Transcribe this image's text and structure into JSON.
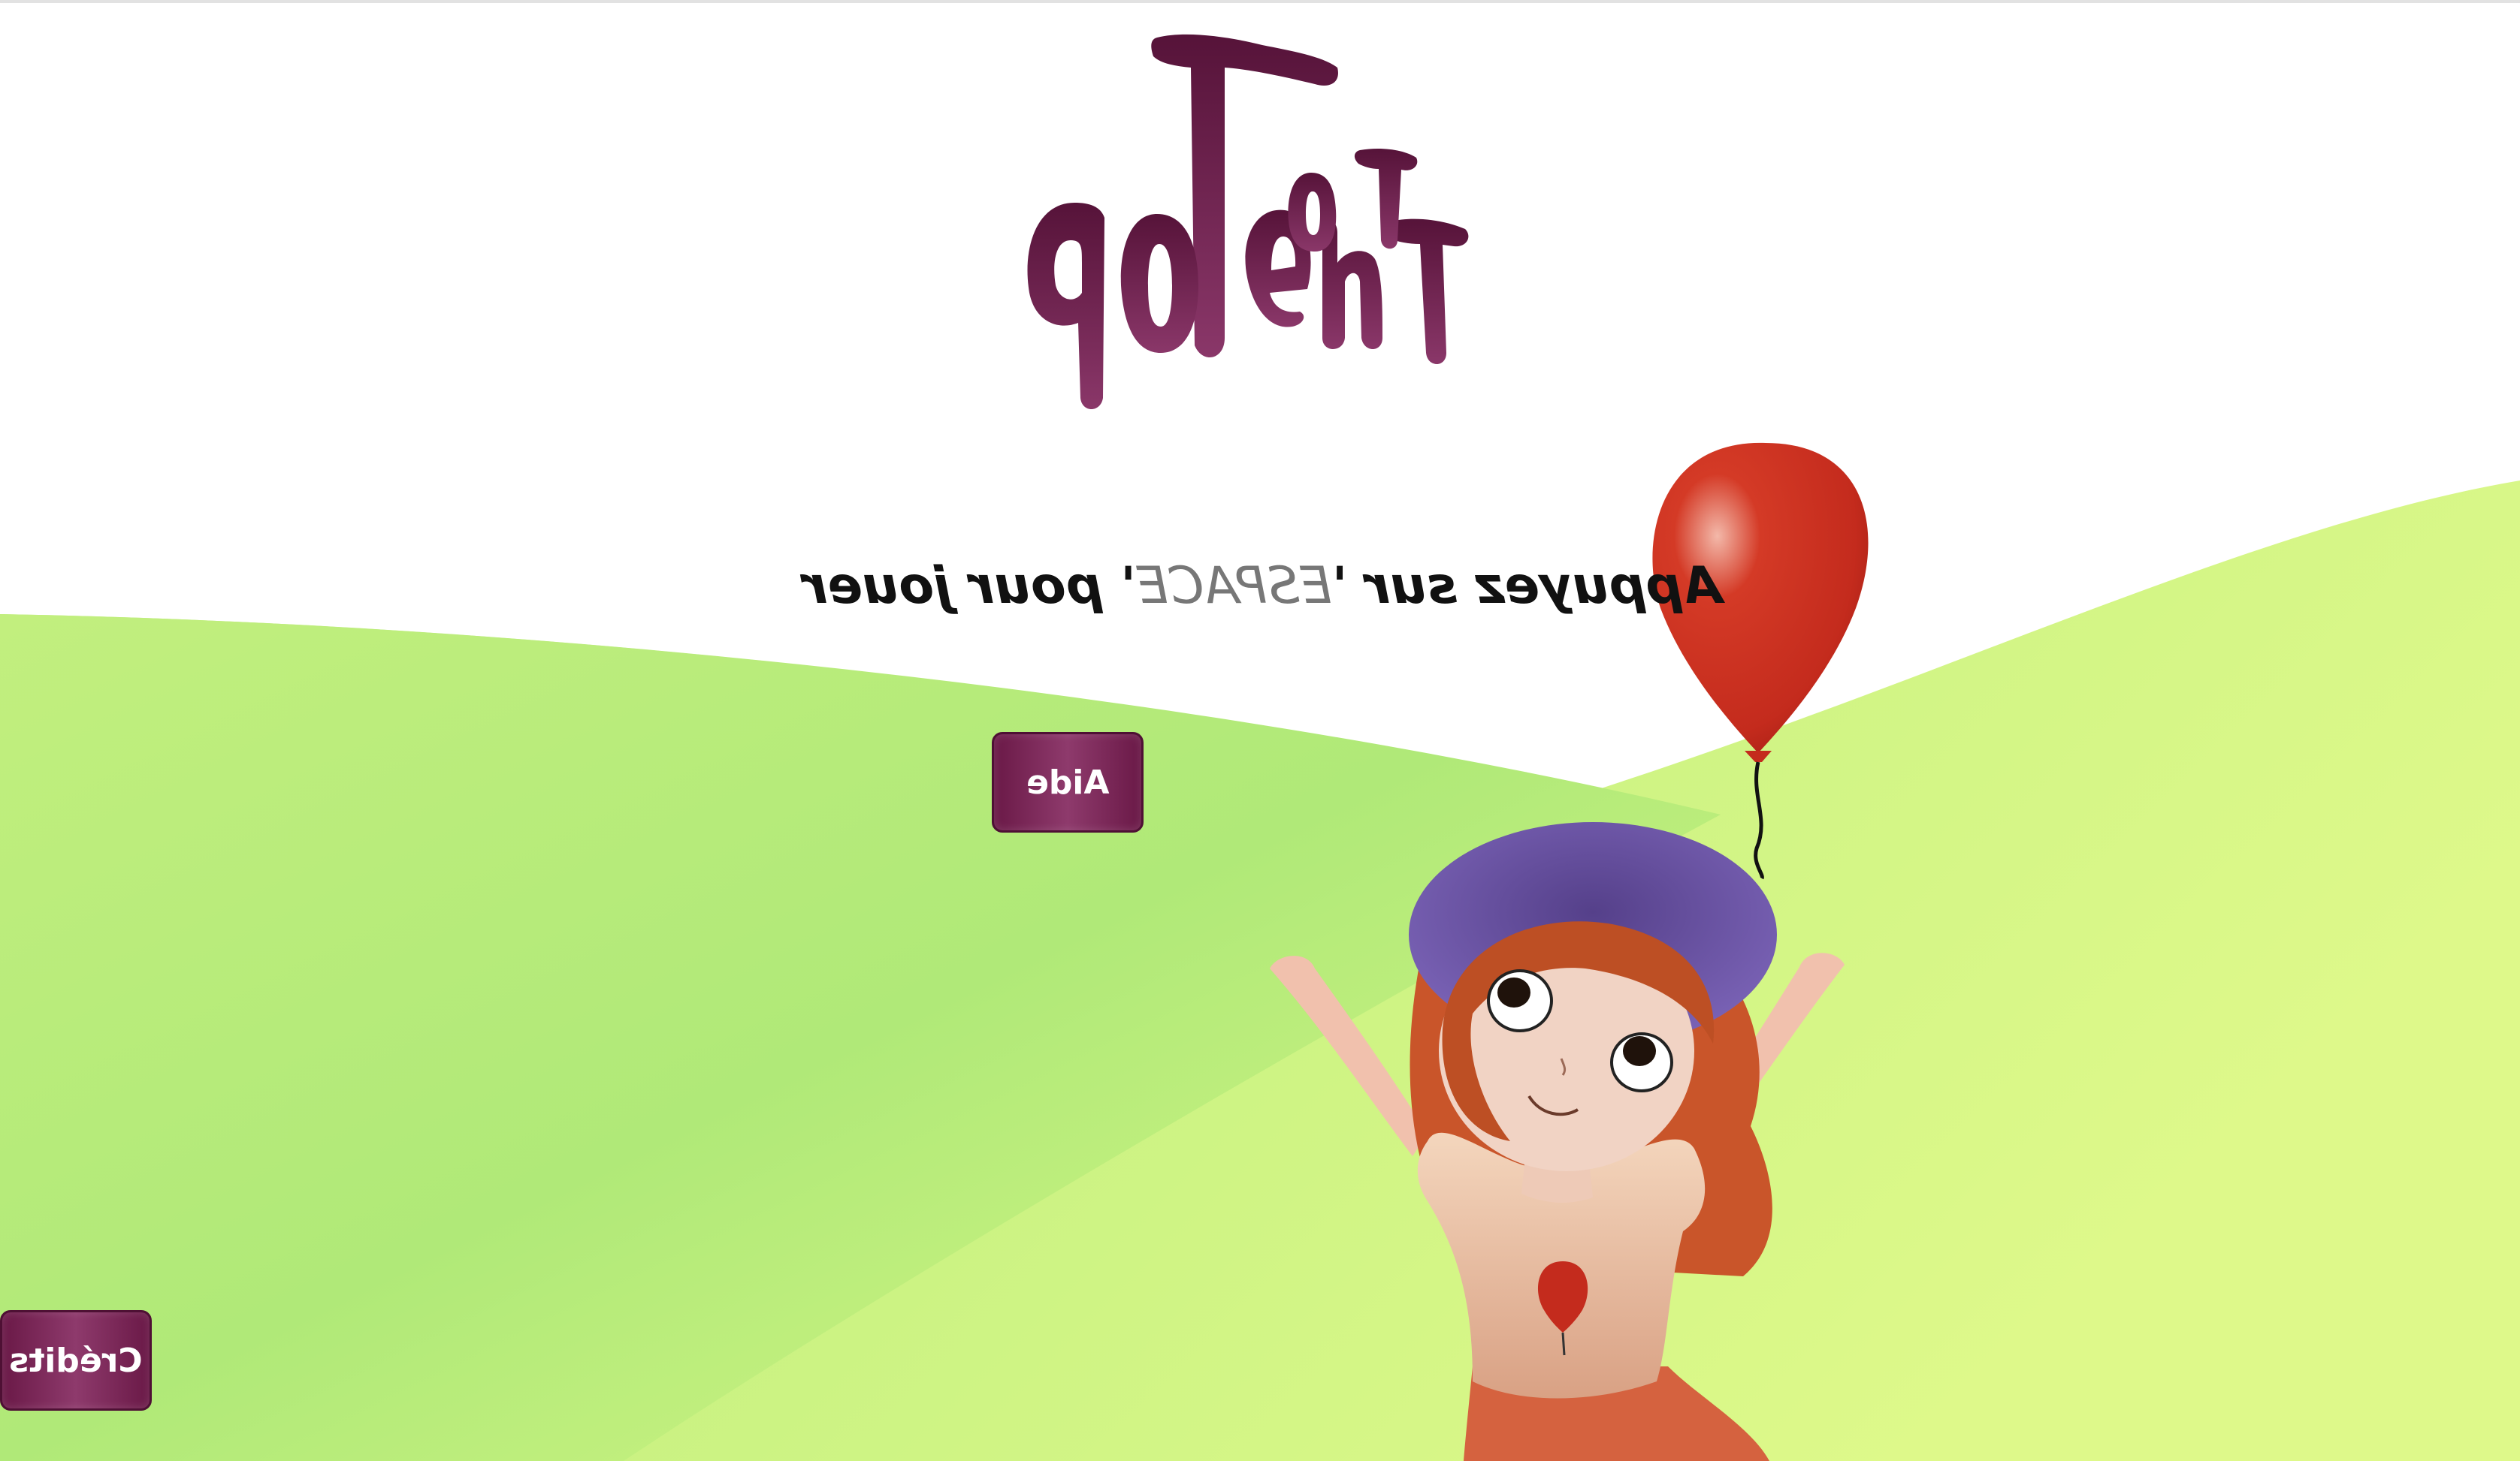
{
  "game": {
    "title": "To The Top",
    "prompt_before": "Appuyez sur '",
    "prompt_key": " ESPACE ",
    "prompt_after": "' pour jouer",
    "help_button": "Aide",
    "credits_button": "Crédits"
  },
  "colors": {
    "brand_purple": "#6a1947",
    "hill_green": "#b4ea7c",
    "balloon_red": "#c7281c",
    "hat_purple": "#7a5fb4"
  },
  "icons": [
    "balloon-icon",
    "heart-balloon-icon"
  ]
}
